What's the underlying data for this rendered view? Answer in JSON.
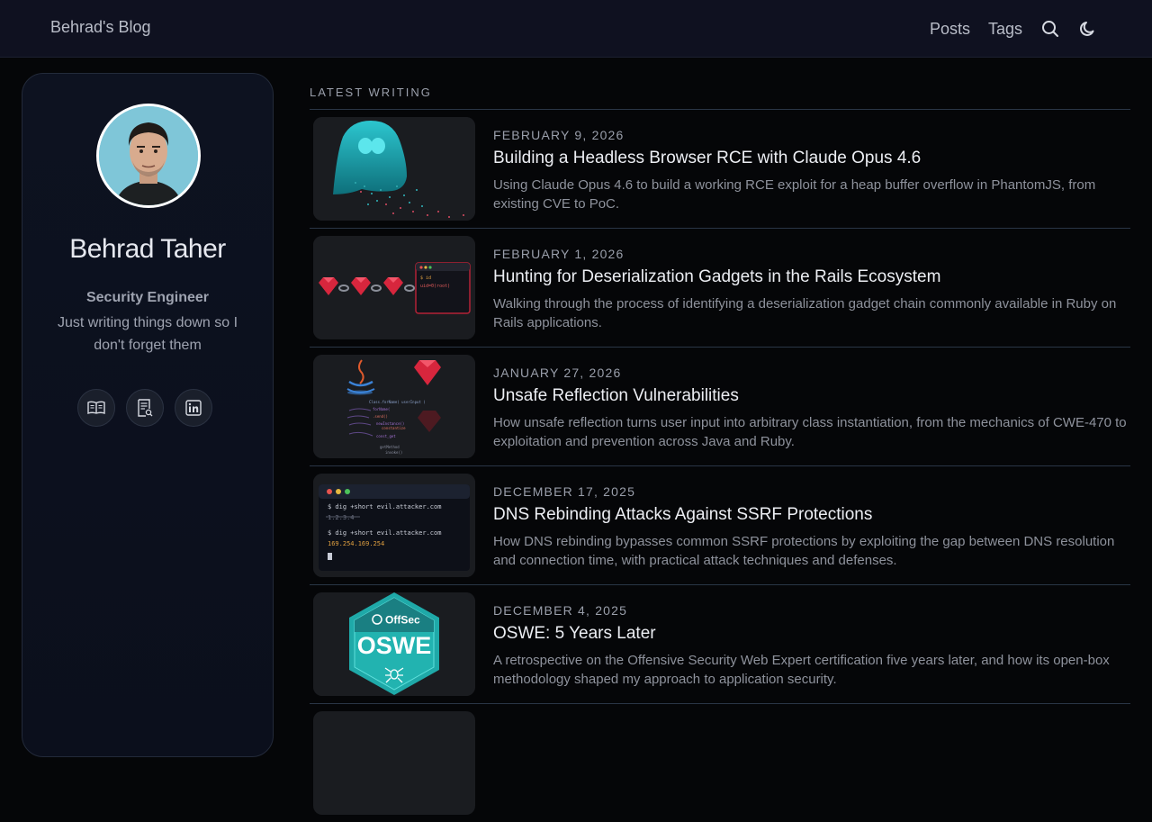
{
  "header": {
    "brand": "Behrad's Blog",
    "nav": [
      {
        "label": "Posts"
      },
      {
        "label": "Tags"
      }
    ],
    "icons": {
      "search": "search-icon",
      "theme": "moon-icon"
    }
  },
  "profile": {
    "name": "Behrad Taher",
    "role": "Security Engineer",
    "tagline": "Just writing things down so I don't forget them",
    "social_icons": [
      "book-icon",
      "resume-icon",
      "linkedin-icon"
    ]
  },
  "section": {
    "title": "LATEST WRITING"
  },
  "posts": [
    {
      "date": "FEBRUARY 9, 2026",
      "title": "Building a Headless Browser RCE with Claude Opus 4.6",
      "description": "Using Claude Opus 4.6 to build a working RCE exploit for a heap buffer overflow in PhantomJS, from existing CVE to PoC."
    },
    {
      "date": "FEBRUARY 1, 2026",
      "title": "Hunting for Deserialization Gadgets in the Rails Ecosystem",
      "description": "Walking through the process of identifying a deserialization gadget chain commonly available in Ruby on Rails applications."
    },
    {
      "date": "JANUARY 27, 2026",
      "title": "Unsafe Reflection Vulnerabilities",
      "description": "How unsafe reflection turns user input into arbitrary class instantiation, from the mechanics of CWE-470 to exploitation and prevention across Java and Ruby."
    },
    {
      "date": "DECEMBER 17, 2025",
      "title": "DNS Rebinding Attacks Against SSRF Protections",
      "description": "How DNS rebinding bypasses common SSRF protections by exploiting the gap between DNS resolution and connection time, with practical attack techniques and defenses."
    },
    {
      "date": "DECEMBER 4, 2025",
      "title": "OSWE: 5 Years Later",
      "description": "A retrospective on the Offensive Security Web Expert certification five years later, and how its open-box methodology shaped my approach to application security."
    }
  ],
  "thumbs": {
    "rails": {
      "cmd": "$ id",
      "out": "uid=0(root)"
    },
    "reflection": {
      "l1": "Class.forName( userInput )",
      "l2": "forName(",
      "l3": ".send()",
      "l4": "newInstance()",
      "l5": "constantize",
      "l6": "const_get",
      "l7": "getMethod",
      "l8": "invoke()"
    },
    "dns": {
      "c1": "$ dig +short evil.attacker.com",
      "o1": "1.2.3.4",
      "c2": "$ dig +short evil.attacker.com",
      "o2": "169.254.169.254"
    },
    "oswe": {
      "brand": "OffSec",
      "label": "OSWE"
    }
  }
}
